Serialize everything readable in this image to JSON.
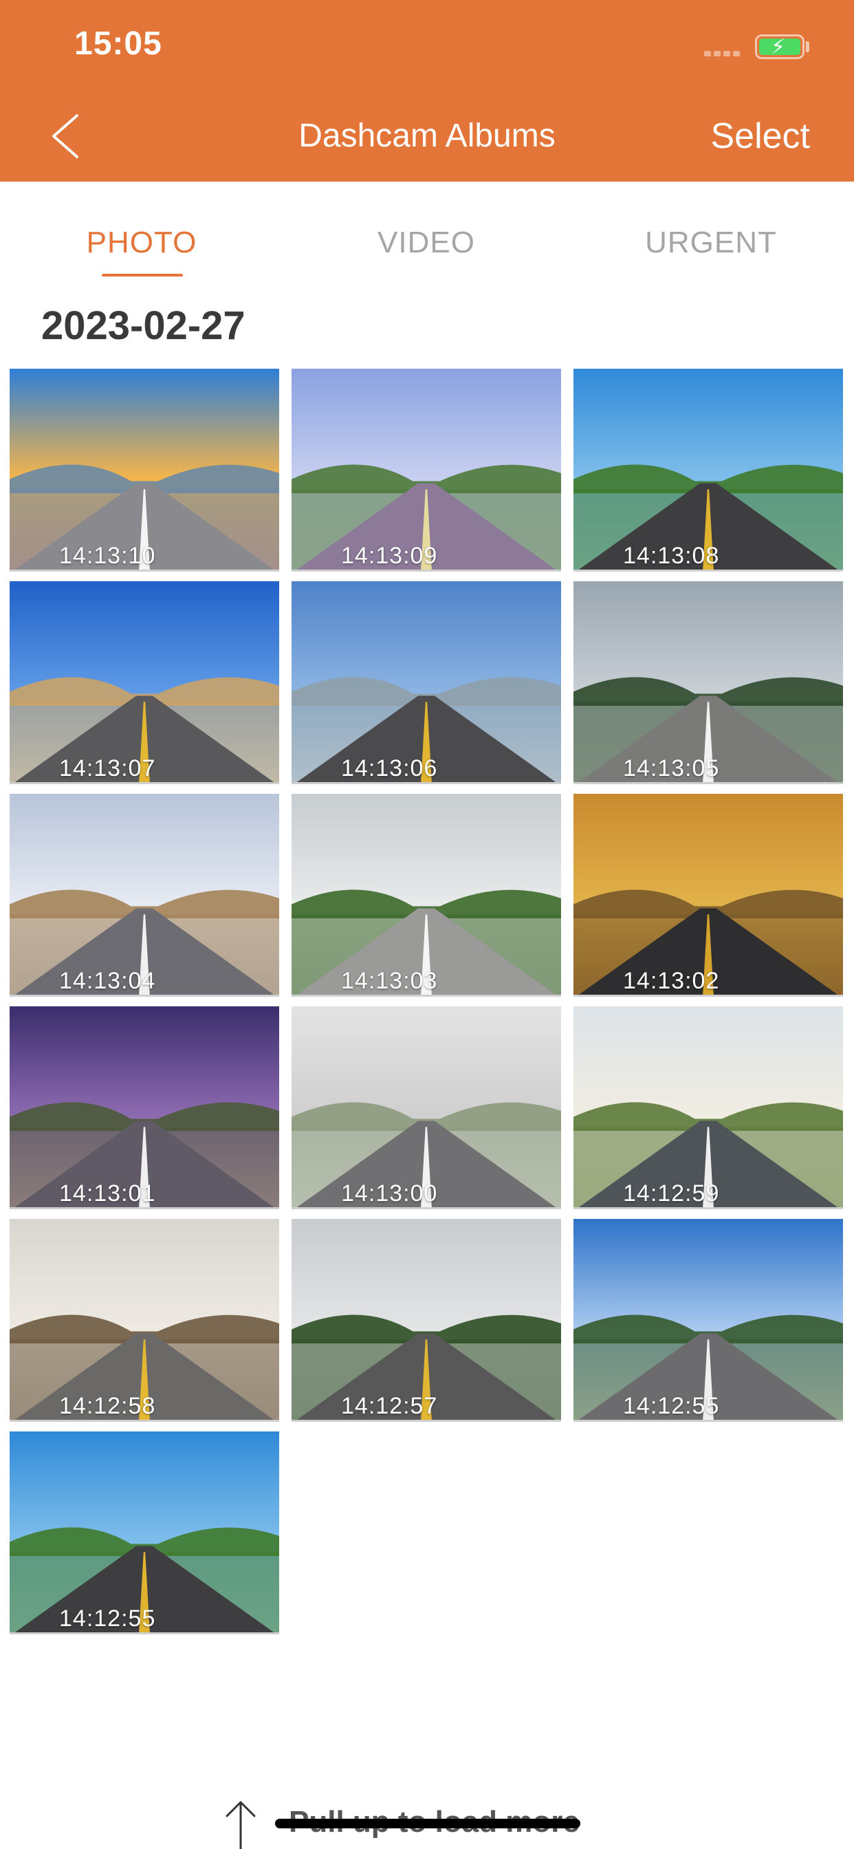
{
  "status_bar": {
    "time": "15:05"
  },
  "nav": {
    "back_icon": "chevron-left-icon",
    "title": "Dashcam Albums",
    "select_label": "Select"
  },
  "tabs": [
    {
      "label": "PHOTO",
      "active": true
    },
    {
      "label": "VIDEO",
      "active": false
    },
    {
      "label": "URGENT",
      "active": false
    }
  ],
  "section": {
    "date": "2023-02-27"
  },
  "photos": [
    {
      "time": "14:13:10",
      "scene": "sunset-road"
    },
    {
      "time": "14:13:09",
      "scene": "avenue-trees"
    },
    {
      "time": "14:13:08",
      "scene": "coastal-curve"
    },
    {
      "time": "14:13:07",
      "scene": "desert-road"
    },
    {
      "time": "14:13:06",
      "scene": "open-highway"
    },
    {
      "time": "14:13:05",
      "scene": "forest-road"
    },
    {
      "time": "14:13:04",
      "scene": "cloudy-plain"
    },
    {
      "time": "14:13:03",
      "scene": "country-lane"
    },
    {
      "time": "14:13:02",
      "scene": "autumn-road"
    },
    {
      "time": "14:13:01",
      "scene": "purple-sky"
    },
    {
      "time": "14:13:00",
      "scene": "foggy-road"
    },
    {
      "time": "14:12:59",
      "scene": "tree-lined"
    },
    {
      "time": "14:12:58",
      "scene": "street-trees"
    },
    {
      "time": "14:12:57",
      "scene": "green-hills"
    },
    {
      "time": "14:12:55",
      "scene": "blue-clouds"
    },
    {
      "time": "14:12:55",
      "scene": "coastal-curve"
    }
  ],
  "footer": {
    "load_more_label": "Pull up to load more",
    "arrow_icon": "arrow-up-icon"
  },
  "colors": {
    "accent": "#E47538",
    "tab_inactive": "#A5A5A5",
    "date_text": "#3A3A3A"
  }
}
